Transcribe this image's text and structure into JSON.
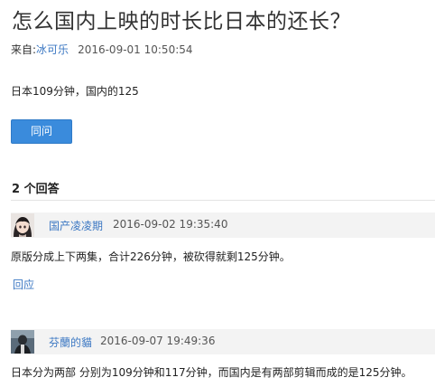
{
  "question": {
    "title": "怎么国内上映的时长比日本的还长？",
    "from_label": "来自:",
    "author": "冰可乐",
    "timestamp": "2016-09-01 10:50:54",
    "body": "日本109分钟，国内的125"
  },
  "actions": {
    "same_question_label": "同问"
  },
  "answers_heading": "2 个回答",
  "answers": [
    {
      "author": "国产凌凌期",
      "timestamp": "2016-09-02 19:35:40",
      "body": "原版分成上下两集，合计226分钟，被砍得就剩125分钟。",
      "reply_label": "回应",
      "avatar": "anime-girl-avatar"
    },
    {
      "author": "芬蘭的貓",
      "timestamp": "2016-09-07 19:49:36",
      "body": "日本分为两部 分别为109分钟和117分钟，而国内是有两部剪辑而成的是125分钟。",
      "avatar": "dark-figure-avatar"
    }
  ]
}
